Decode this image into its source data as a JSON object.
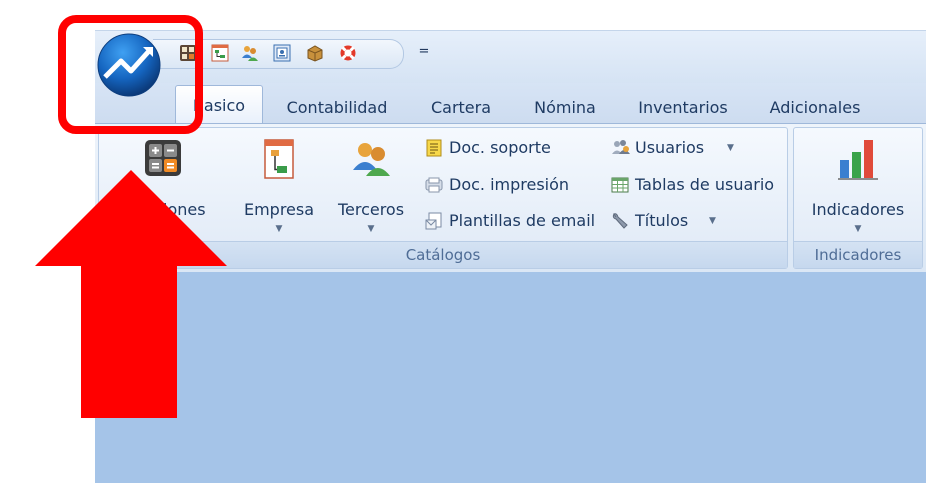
{
  "tabs": [
    {
      "id": "basico",
      "label": "Basico",
      "active": true
    },
    {
      "id": "contabilidad",
      "label": "Contabilidad"
    },
    {
      "id": "cartera",
      "label": "Cartera"
    },
    {
      "id": "nomina",
      "label": "Nómina"
    },
    {
      "id": "inventarios",
      "label": "Inventarios"
    },
    {
      "id": "adicionales",
      "label": "Adicionales"
    }
  ],
  "quick_access": {
    "icons": [
      "grid-icon",
      "org-chart-icon",
      "users-icon",
      "document-icon",
      "package-icon",
      "lifebuoy-icon"
    ],
    "customize_symbol": "="
  },
  "ribbon": {
    "catalogos": {
      "caption": "Catálogos",
      "big_buttons": [
        {
          "id": "aplicaciones",
          "label": "aciones",
          "icon": "calculator-icon"
        },
        {
          "id": "empresa",
          "label": "Empresa",
          "icon": "org-chart-icon"
        },
        {
          "id": "terceros",
          "label": "Terceros",
          "icon": "users-icon"
        }
      ],
      "small_buttons": [
        {
          "id": "doc-soporte",
          "label": "Doc. soporte",
          "icon": "document-icon"
        },
        {
          "id": "doc-impresion",
          "label": "Doc. impresión",
          "icon": "printer-doc-icon"
        },
        {
          "id": "plantillas-email",
          "label": "Plantillas de email",
          "icon": "email-template-icon"
        },
        {
          "id": "usuarios",
          "label": "Usuarios",
          "icon": "users-group-icon",
          "dropdown": true
        },
        {
          "id": "tablas-usuario",
          "label": "Tablas de usuario",
          "icon": "table-icon"
        },
        {
          "id": "titulos",
          "label": "Títulos",
          "icon": "wrench-icon",
          "dropdown": true
        }
      ]
    },
    "indicadores": {
      "caption": "Indicadores",
      "big_buttons": [
        {
          "id": "indicadores",
          "label": "Indicadores",
          "icon": "bar-chart-icon"
        }
      ]
    }
  },
  "colors": {
    "workspace": "#a5c4e8",
    "highlight": "#ff0000",
    "text": "#1f3b63"
  }
}
